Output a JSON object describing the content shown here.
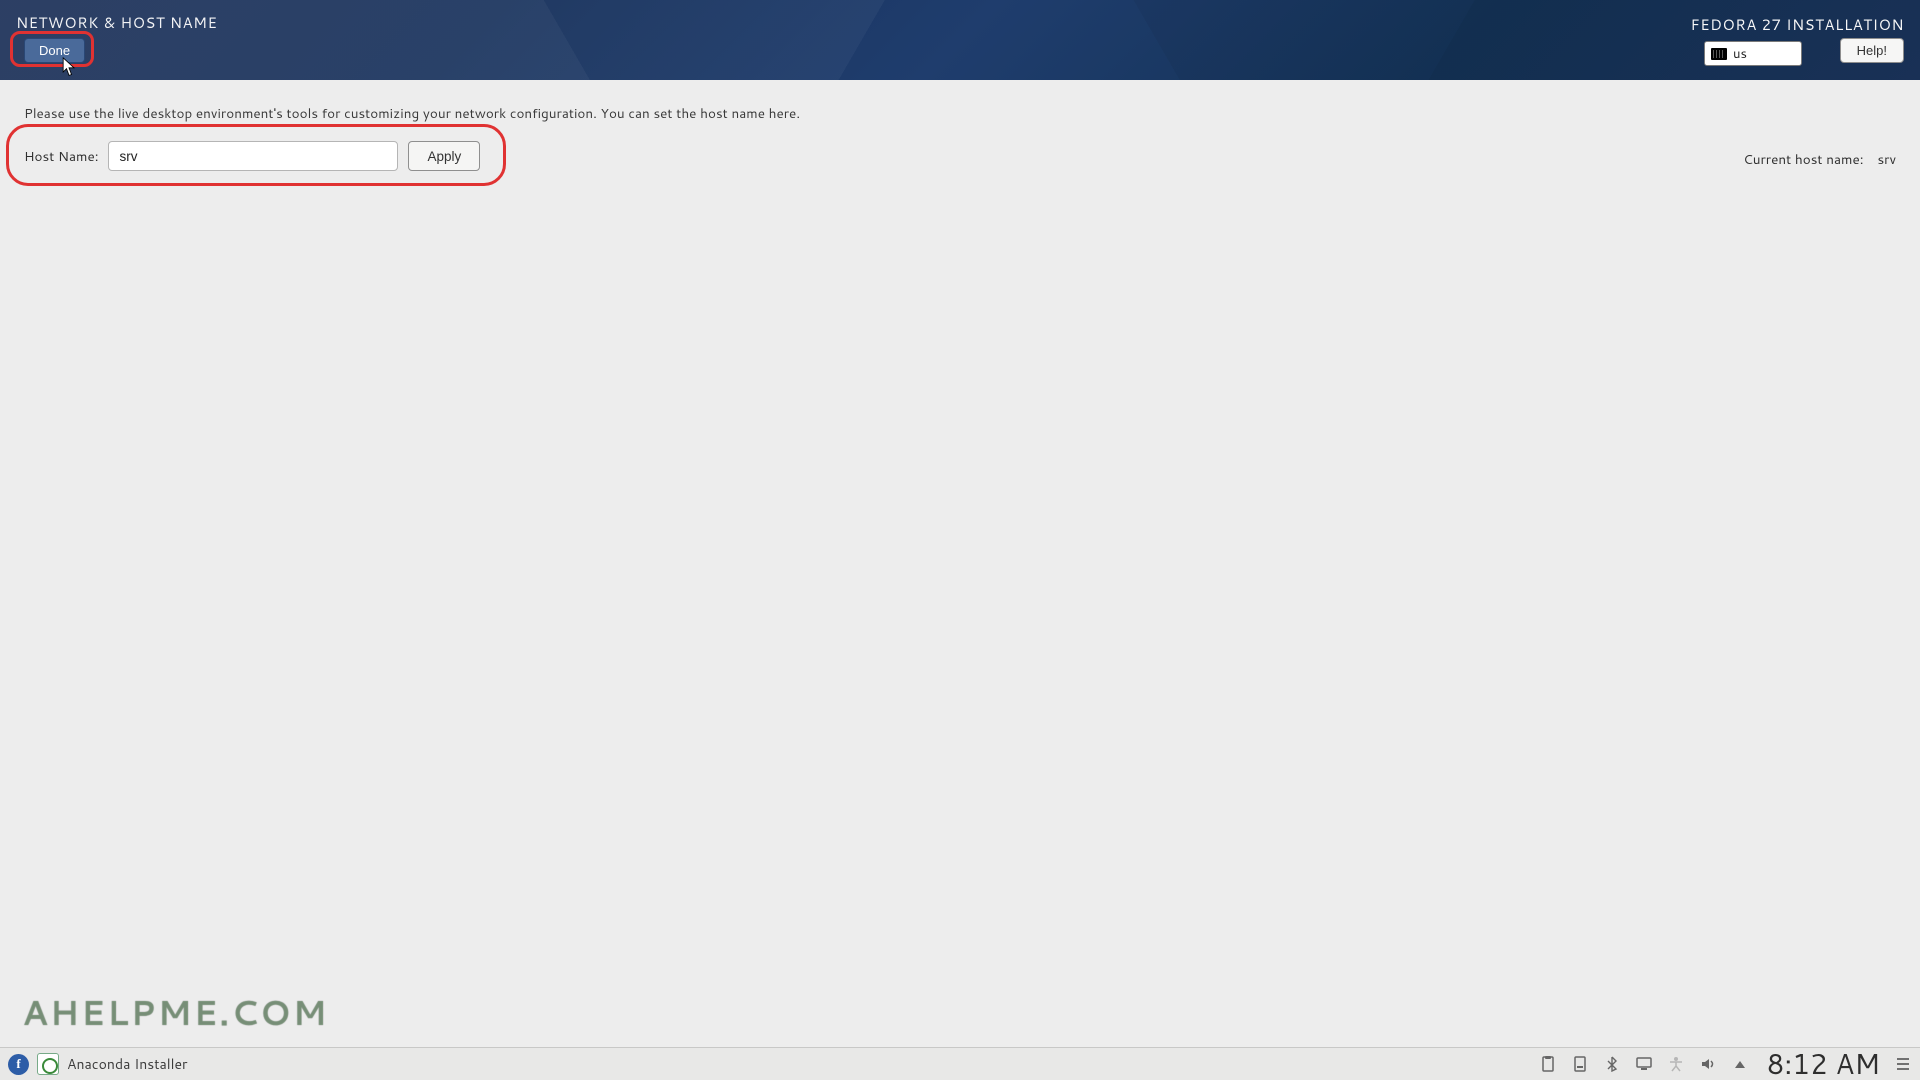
{
  "header": {
    "title": "NETWORK & HOST NAME",
    "install_title": "FEDORA 27 INSTALLATION",
    "done_label": "Done",
    "help_label": "Help!",
    "keyboard_layout": "us"
  },
  "main": {
    "instruction": "Please use the live desktop environment's tools for customizing your network configuration.  You can set the host name here.",
    "host_label": "Host Name:",
    "host_value": "srv",
    "apply_label": "Apply",
    "current_host_label": "Current host name:",
    "current_host_value": "srv"
  },
  "watermark": "AHELPME.COM",
  "taskbar": {
    "app_label": "Anaconda Installer",
    "clock": "8:12 AM"
  }
}
